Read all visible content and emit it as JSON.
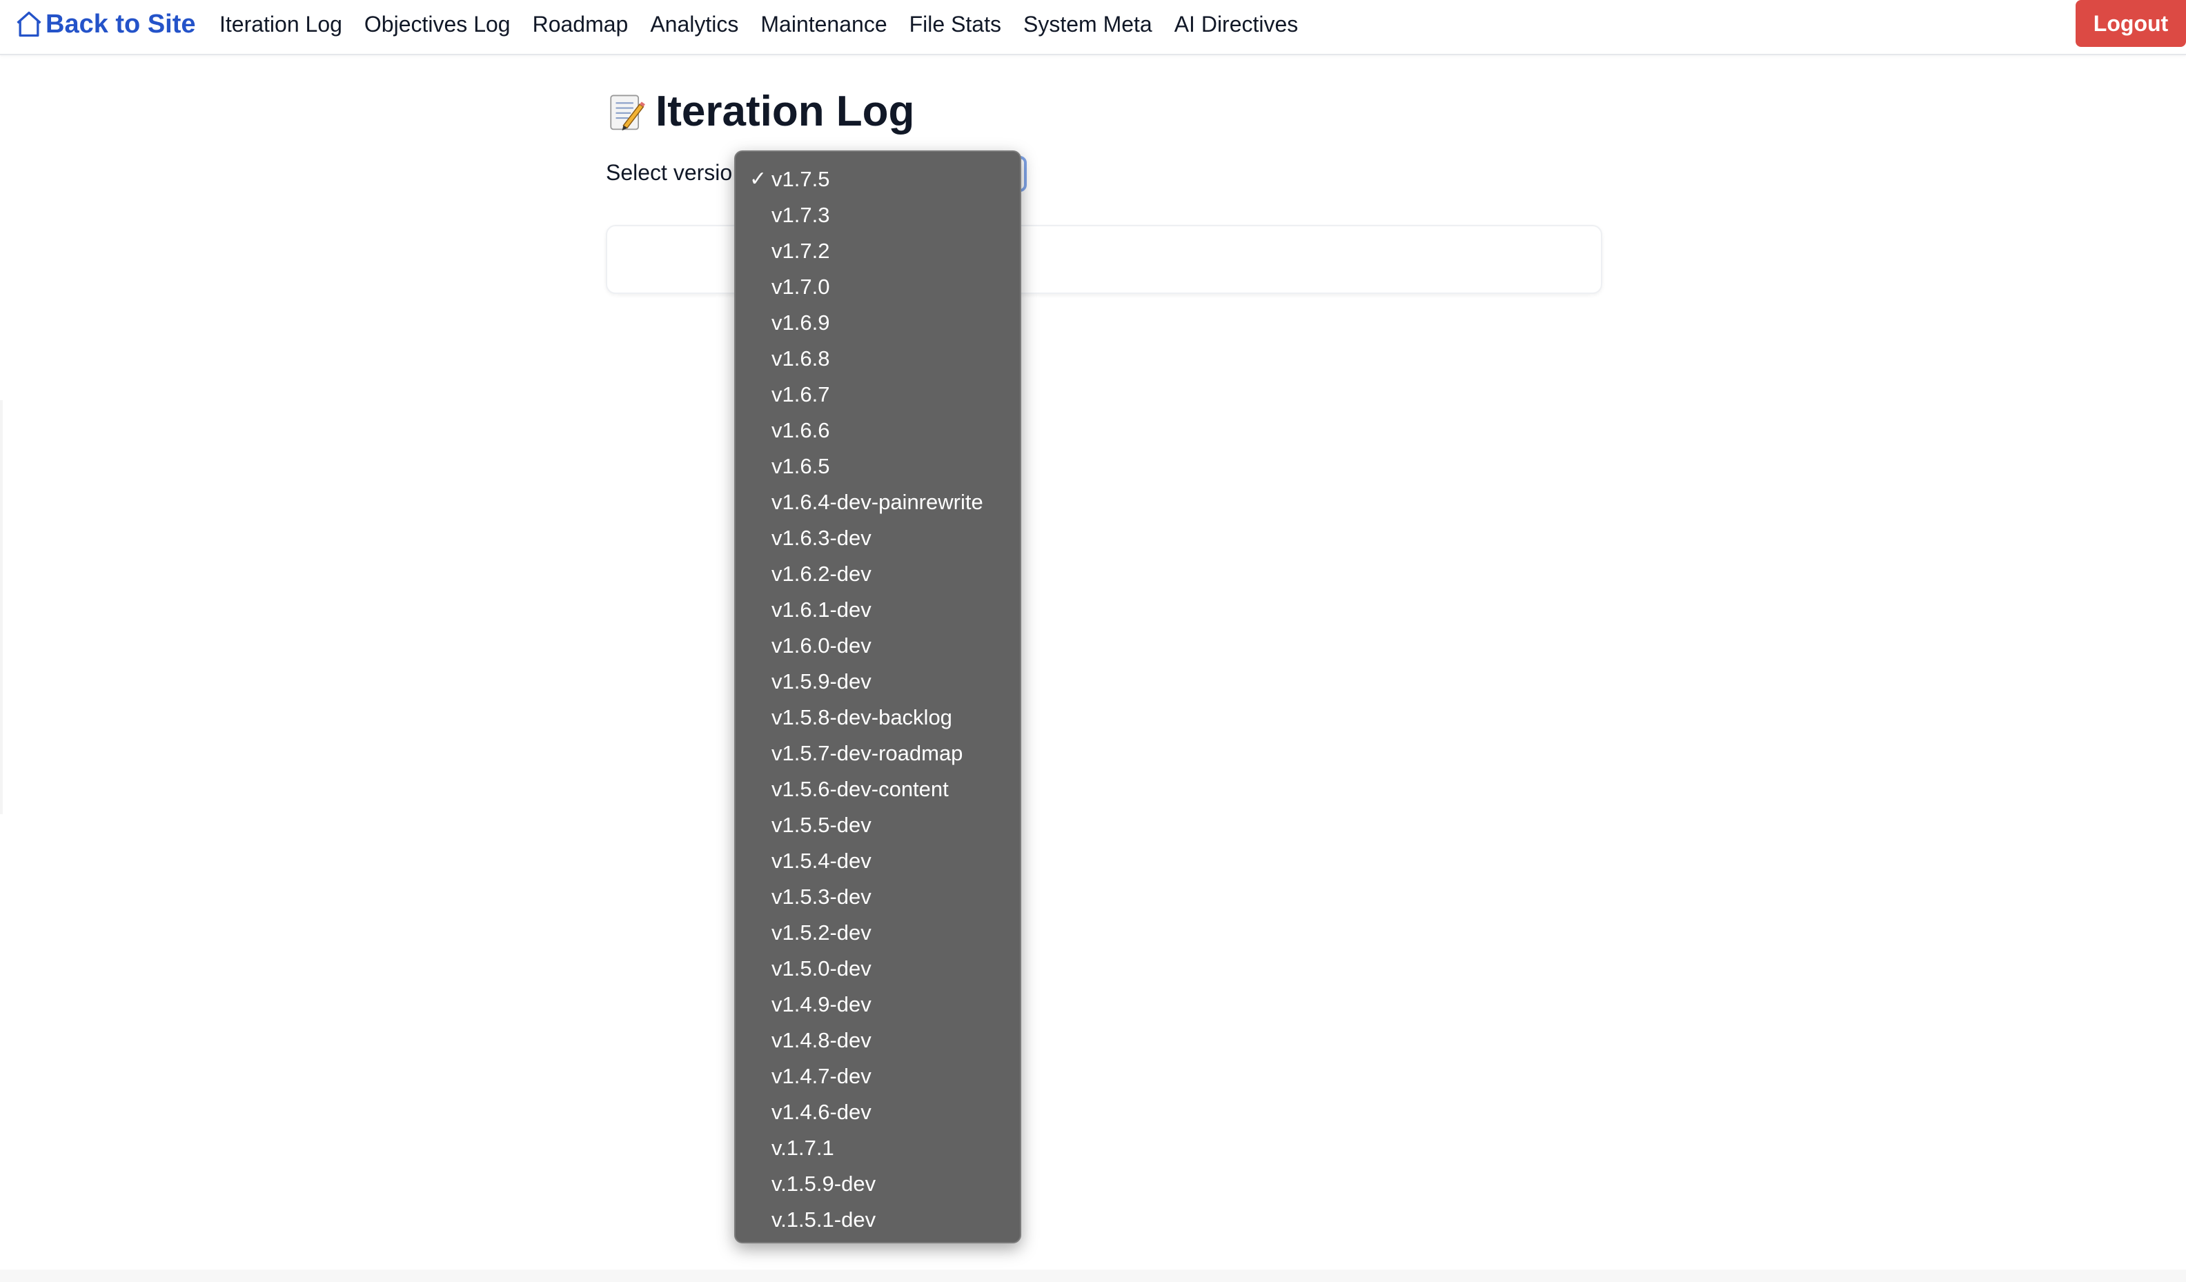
{
  "nav": {
    "home_label": "Back to Site",
    "links": [
      "Iteration Log",
      "Objectives Log",
      "Roadmap",
      "Analytics",
      "Maintenance",
      "File Stats",
      "System Meta",
      "AI Directives"
    ],
    "logout_label": "Logout"
  },
  "colors": {
    "brand_blue": "#2453c9",
    "logout_red": "#dc4a44",
    "dropdown_bg": "#626262"
  },
  "main": {
    "title": "Iteration Log",
    "title_icon": "memo-icon",
    "select_label": "Select versio",
    "selected_version": "v1.7.5"
  },
  "dropdown": {
    "check_mark": "✓",
    "options": [
      "v1.7.5",
      "v1.7.3",
      "v1.7.2",
      "v1.7.0",
      "v1.6.9",
      "v1.6.8",
      "v1.6.7",
      "v1.6.6",
      "v1.6.5",
      "v1.6.4-dev-painrewrite",
      "v1.6.3-dev",
      "v1.6.2-dev",
      "v1.6.1-dev",
      "v1.6.0-dev",
      "v1.5.9-dev",
      "v1.5.8-dev-backlog",
      "v1.5.7-dev-roadmap",
      "v1.5.6-dev-content",
      "v1.5.5-dev",
      "v1.5.4-dev",
      "v1.5.3-dev",
      "v1.5.2-dev",
      "v1.5.0-dev",
      "v1.4.9-dev",
      "v1.4.8-dev",
      "v1.4.7-dev",
      "v1.4.6-dev",
      "v.1.7.1",
      "v.1.5.9-dev",
      "v.1.5.1-dev"
    ]
  }
}
